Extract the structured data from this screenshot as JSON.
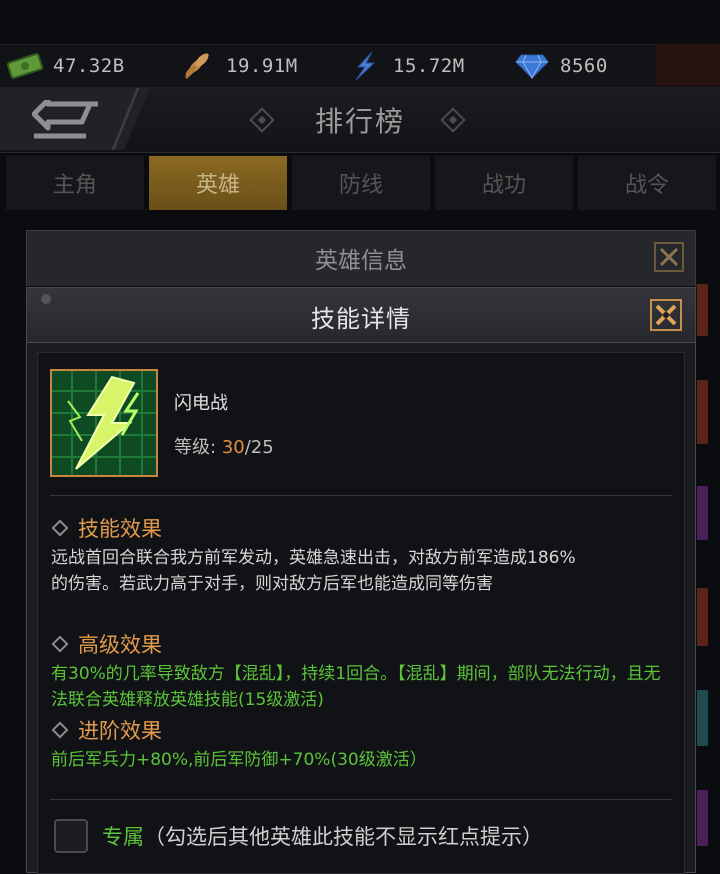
{
  "resources": [
    {
      "icon": "cash-icon",
      "value": "47.32B"
    },
    {
      "icon": "wheat-icon",
      "value": "19.91M"
    },
    {
      "icon": "lightning-icon",
      "value": "15.72M"
    },
    {
      "icon": "diamond-icon",
      "value": "8560"
    }
  ],
  "header": {
    "title": "排行榜"
  },
  "tabs": [
    "主角",
    "英雄",
    "防线",
    "战功",
    "战令"
  ],
  "active_tab": "英雄",
  "hero_info": {
    "title": "英雄信息"
  },
  "dialog": {
    "title": "技能详情",
    "skill": {
      "name": "闪电战",
      "level_label": "等级:",
      "level_current": "30",
      "level_sep": "/",
      "level_max": "25"
    },
    "sections": [
      {
        "title": "技能效果",
        "text": "远战首回合联合我方前军发动，英雄急速出击，对敌方前军造成186%的伤害。若武力高于对手，则对敌方后军也能造成同等伤害"
      },
      {
        "title": "高级效果",
        "text": "有30%的几率导致敌方【混乱】，持续1回合。【混乱】期间，部队无法行动，且无法联合英雄释放英雄技能(15级激活)"
      },
      {
        "title": "进阶效果",
        "text": "前后军兵力+80%,前后军防御+70%(30级激活）"
      }
    ],
    "exclusive": {
      "label": "专属",
      "note": "（勾选后其他英雄此技能不显示红点提示）"
    }
  },
  "colors": {
    "accent": "#e29a4c",
    "green": "#5bc43a",
    "tab_active": "#8a6a22",
    "level_current": "#e3903a"
  }
}
